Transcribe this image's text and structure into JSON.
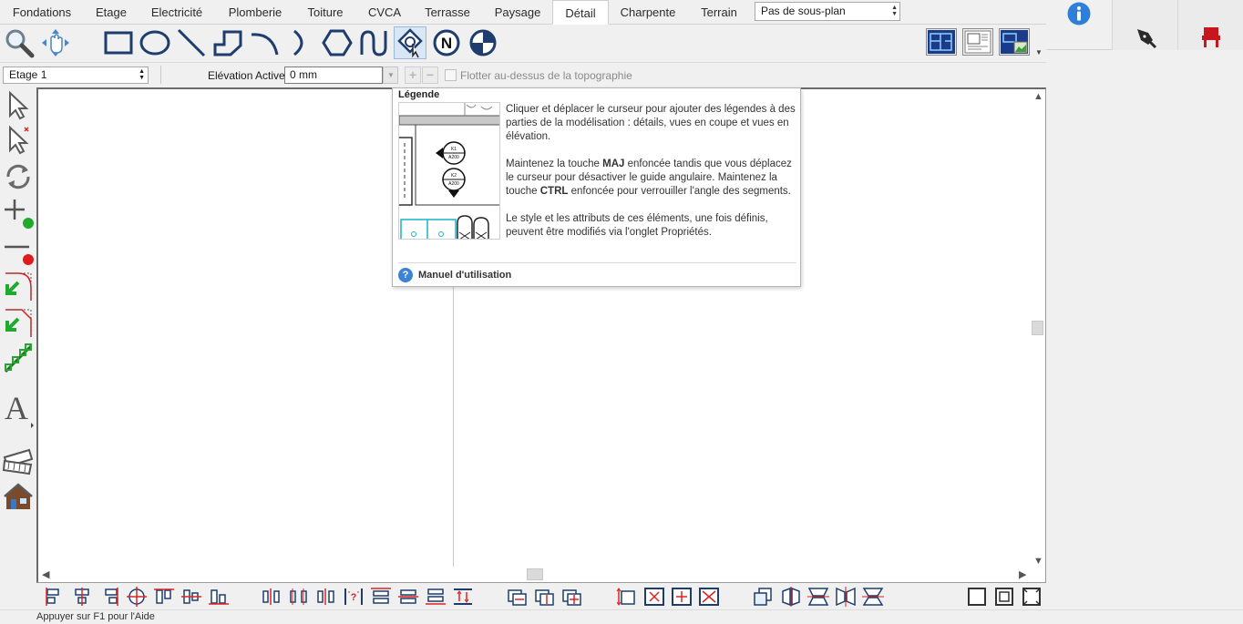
{
  "tabs": [
    {
      "label": "Fondations"
    },
    {
      "label": "Etage"
    },
    {
      "label": "Electricité"
    },
    {
      "label": "Plomberie"
    },
    {
      "label": "Toiture"
    },
    {
      "label": "CVCA"
    },
    {
      "label": "Terrasse"
    },
    {
      "label": "Paysage"
    },
    {
      "label": "Détail",
      "active": true
    },
    {
      "label": "Charpente"
    },
    {
      "label": "Terrain"
    }
  ],
  "subplan_select": {
    "value": "Pas de sous-plan"
  },
  "options": {
    "floor_select": "Etage 1",
    "elevation_label": "Elévation Active:",
    "elevation_value": "0 mm",
    "plus": "+",
    "minus": "−",
    "float_label": "Flotter au-dessus de la topographie"
  },
  "tools": [
    {
      "icon": "zoom-icon"
    },
    {
      "icon": "pan-icon"
    },
    {
      "icon": "rectangle-icon"
    },
    {
      "icon": "ellipse-icon"
    },
    {
      "icon": "line-icon"
    },
    {
      "icon": "polyline-icon"
    },
    {
      "icon": "arc-icon"
    },
    {
      "icon": "half-circle-icon"
    },
    {
      "icon": "hexagon-icon"
    },
    {
      "icon": "spline-icon"
    },
    {
      "icon": "callout-icon",
      "selected": true
    },
    {
      "icon": "north-arrow-icon"
    },
    {
      "icon": "section-marker-icon"
    }
  ],
  "tooltip": {
    "title": "Légende",
    "paragraph1": "Cliquer et déplacer le curseur pour ajouter des légendes à des parties de la modélisation : détails, vues en coupe et vues en élévation.",
    "paragraph2_pre": "Maintenez la touche ",
    "paragraph2_key1": "MAJ",
    "paragraph2_mid": " enfoncée tandis que vous déplacez le curseur pour désactiver le guide angulaire. Maintenez la touche ",
    "paragraph2_key2": "CTRL",
    "paragraph2_post": " enfoncée pour verrouiller l'angle des segments.",
    "paragraph3": "Le style et les attributs de ces éléments, une fois définis, peuvent être modifiés via l'onglet Propriétés.",
    "manual_link": "Manuel d'utilisation",
    "help_icon": "?",
    "preview_labels": {
      "k1": "K1",
      "k2": "K2",
      "ref": "A200"
    }
  },
  "status_text": "Appuyer sur F1 pour l'Aide",
  "colors": {
    "tool_blue": "#1e3d6e",
    "accent_green": "#1faa2e",
    "accent_red": "#e01b1b",
    "info_blue": "#2f7fd8",
    "chair_red": "#c8161d"
  }
}
